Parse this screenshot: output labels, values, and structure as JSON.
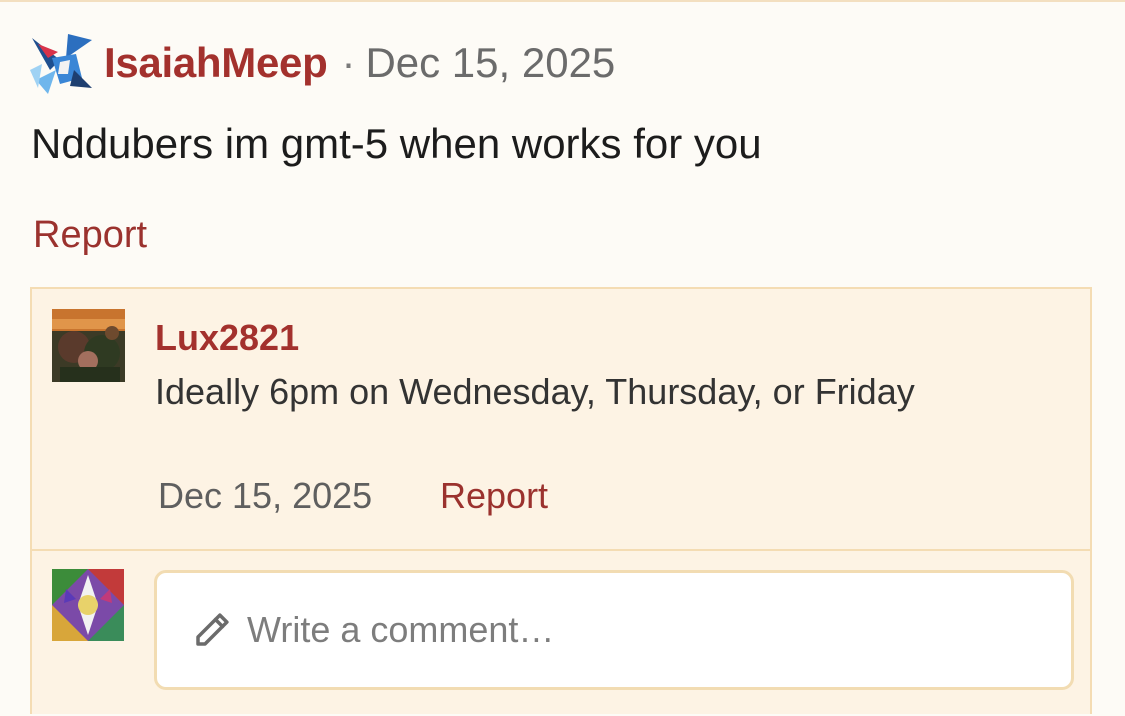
{
  "post": {
    "author": "IsaiahMeep",
    "separator": "·",
    "date": "Dec 15, 2025",
    "body": "Nddubers im gmt-5 when works for you",
    "report_label": "Report"
  },
  "reply": {
    "author": "Lux2821",
    "text": "Ideally 6pm on Wednesday, Thursday, or Friday",
    "date": "Dec 15, 2025",
    "report_label": "Report"
  },
  "compose": {
    "placeholder": "Write a comment…",
    "icon": "pencil-icon"
  },
  "colors": {
    "accent": "#a3312d",
    "background": "#fdfbf6",
    "reply_background": "#fdf3e4",
    "border": "#f4dcb3"
  }
}
